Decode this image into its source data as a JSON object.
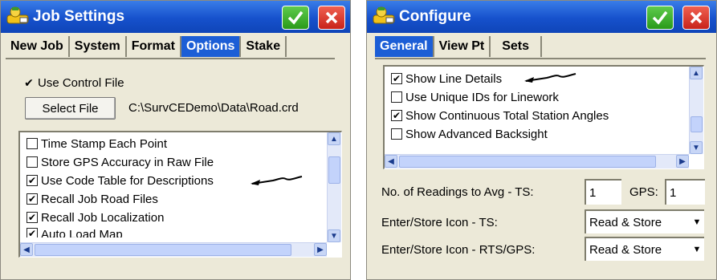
{
  "job_settings": {
    "title": "Job Settings",
    "tabs": [
      {
        "label": "New Job",
        "active": false
      },
      {
        "label": "System",
        "active": false
      },
      {
        "label": "Format",
        "active": false
      },
      {
        "label": "Options",
        "active": true
      },
      {
        "label": "Stake",
        "active": false
      }
    ],
    "use_control_file": {
      "label": "Use Control File",
      "checked": true
    },
    "select_file_label": "Select File",
    "file_path": "C:\\SurvCEDemo\\Data\\Road.crd",
    "options_list": [
      {
        "label": "Time Stamp Each Point",
        "checked": false
      },
      {
        "label": "Store GPS Accuracy in Raw File",
        "checked": false
      },
      {
        "label": "Use Code Table for Descriptions",
        "checked": true
      },
      {
        "label": "Recall Job Road Files",
        "checked": true
      },
      {
        "label": "Recall Job Localization",
        "checked": true
      },
      {
        "label": "Auto Load Map",
        "checked": true
      }
    ]
  },
  "configure": {
    "title": "Configure",
    "tabs": [
      {
        "label": "General",
        "active": true
      },
      {
        "label": "View Pt",
        "active": false
      },
      {
        "label": "Sets",
        "active": false
      }
    ],
    "options_list": [
      {
        "label": "Show Line Details",
        "checked": true
      },
      {
        "label": "Use Unique IDs for Linework",
        "checked": false
      },
      {
        "label": "Show Continuous Total Station Angles",
        "checked": true
      },
      {
        "label": "Show Advanced Backsight",
        "checked": false
      }
    ],
    "readings": {
      "label": "No. of Readings to Avg  -  TS:",
      "ts_value": "1",
      "gps_label": "GPS:",
      "gps_value": "1"
    },
    "store_icon_ts": {
      "label": "Enter/Store Icon - TS:",
      "value": "Read & Store"
    },
    "store_icon_rts": {
      "label": "Enter/Store Icon - RTS/GPS:",
      "value": "Read & Store"
    }
  }
}
